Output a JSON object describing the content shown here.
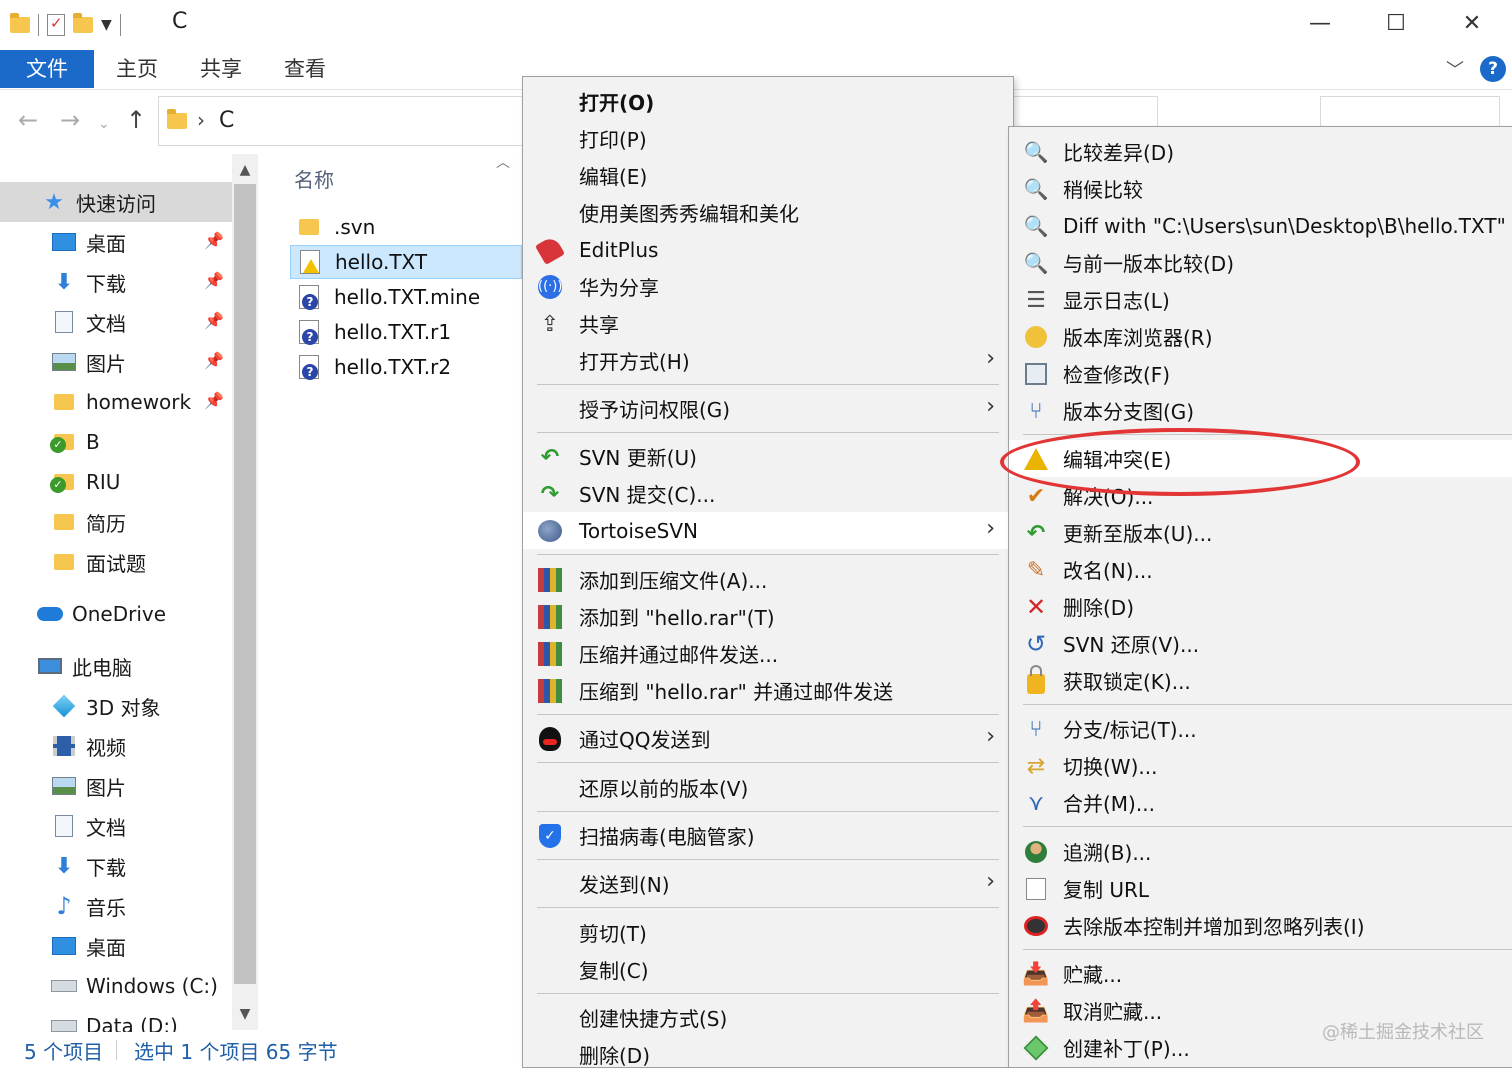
{
  "window": {
    "title": "C",
    "minimize_glyph": "—",
    "maximize_glyph": "☐",
    "close_glyph": "✕"
  },
  "ribbon": {
    "tabs": [
      "文件",
      "主页",
      "共享",
      "查看"
    ],
    "help": "?"
  },
  "address": {
    "path": "C"
  },
  "navpane": {
    "quick_access": "快速访问",
    "items": [
      {
        "label": "桌面",
        "icon": "desktop-icon",
        "pinned": true
      },
      {
        "label": "下载",
        "icon": "download-icon",
        "pinned": true
      },
      {
        "label": "文档",
        "icon": "document-icon",
        "pinned": true
      },
      {
        "label": "图片",
        "icon": "picture-icon",
        "pinned": true
      },
      {
        "label": "homework",
        "icon": "folder-icon",
        "pinned": true
      },
      {
        "label": "B",
        "icon": "svn-folder-icon",
        "pinned": false
      },
      {
        "label": "RIU",
        "icon": "svn-folder-icon",
        "pinned": false
      },
      {
        "label": "简历",
        "icon": "folder-icon",
        "pinned": false
      },
      {
        "label": "面试题",
        "icon": "folder-icon",
        "pinned": false
      }
    ],
    "onedrive": "OneDrive",
    "this_pc": "此电脑",
    "pc_items": [
      {
        "label": "3D 对象",
        "icon": "3d-objects-icon"
      },
      {
        "label": "视频",
        "icon": "video-icon"
      },
      {
        "label": "图片",
        "icon": "picture-icon"
      },
      {
        "label": "文档",
        "icon": "document-icon"
      },
      {
        "label": "下载",
        "icon": "download-icon"
      },
      {
        "label": "音乐",
        "icon": "music-icon"
      },
      {
        "label": "桌面",
        "icon": "desktop-icon"
      },
      {
        "label": "Windows (C:)",
        "icon": "drive-icon"
      },
      {
        "label": "Data (D:)",
        "icon": "drive-icon"
      }
    ]
  },
  "filelist": {
    "column_name": "名称",
    "files": [
      {
        "name": ".svn",
        "icon": "folder-icon",
        "selected": false
      },
      {
        "name": "hello.TXT",
        "icon": "conflict-file-icon",
        "selected": true
      },
      {
        "name": "hello.TXT.mine",
        "icon": "unversioned-file-icon",
        "selected": false
      },
      {
        "name": "hello.TXT.r1",
        "icon": "unversioned-file-icon",
        "selected": false
      },
      {
        "name": "hello.TXT.r2",
        "icon": "unversioned-file-icon",
        "selected": false
      }
    ]
  },
  "status": {
    "count": "5 个项目",
    "selection": "选中 1 个项目  65 字节"
  },
  "menu1": {
    "items": [
      {
        "label": "打开(O)"
      },
      {
        "label": "打印(P)"
      },
      {
        "label": "编辑(E)"
      },
      {
        "label": "使用美图秀秀编辑和美化"
      },
      {
        "label": "EditPlus"
      },
      {
        "label": "华为分享"
      },
      {
        "label": "共享"
      },
      {
        "label": "打开方式(H)"
      },
      {
        "label": "授予访问权限(G)"
      },
      {
        "label": "SVN 更新(U)"
      },
      {
        "label": "SVN 提交(C)..."
      },
      {
        "label": "TortoiseSVN"
      },
      {
        "label": "添加到压缩文件(A)..."
      },
      {
        "label": "添加到 \"hello.rar\"(T)"
      },
      {
        "label": "压缩并通过邮件发送..."
      },
      {
        "label": "压缩到 \"hello.rar\" 并通过邮件发送"
      },
      {
        "label": "通过QQ发送到"
      },
      {
        "label": "还原以前的版本(V)"
      },
      {
        "label": "扫描病毒(电脑管家)"
      },
      {
        "label": "发送到(N)"
      },
      {
        "label": "剪切(T)"
      },
      {
        "label": "复制(C)"
      },
      {
        "label": "创建快捷方式(S)"
      },
      {
        "label": "删除(D)"
      }
    ],
    "submenu_arrow": "›"
  },
  "menu2": {
    "items": [
      {
        "label": "比较差异(D)"
      },
      {
        "label": "稍候比较"
      },
      {
        "label": "Diff with \"C:\\Users\\sun\\Desktop\\B\\hello.TXT\""
      },
      {
        "label": "与前一版本比较(D)"
      },
      {
        "label": "显示日志(L)"
      },
      {
        "label": "版本库浏览器(R)"
      },
      {
        "label": "检查修改(F)"
      },
      {
        "label": "版本分支图(G)"
      },
      {
        "label": "编辑冲突(E)"
      },
      {
        "label": "解决(O)..."
      },
      {
        "label": "更新至版本(U)..."
      },
      {
        "label": "改名(N)..."
      },
      {
        "label": "删除(D)"
      },
      {
        "label": "SVN 还原(V)..."
      },
      {
        "label": "获取锁定(K)..."
      },
      {
        "label": "分支/标记(T)..."
      },
      {
        "label": "切换(W)..."
      },
      {
        "label": "合并(M)..."
      },
      {
        "label": "追溯(B)..."
      },
      {
        "label": "复制 URL"
      },
      {
        "label": "去除版本控制并增加到忽略列表(I)"
      },
      {
        "label": "贮藏..."
      },
      {
        "label": "取消贮藏..."
      },
      {
        "label": "创建补丁(P)..."
      }
    ]
  },
  "watermark": "@稀土掘金技术社区",
  "colors": {
    "accent": "#1b6ac9",
    "selection": "#cce8ff",
    "annotation": "#e23636"
  }
}
